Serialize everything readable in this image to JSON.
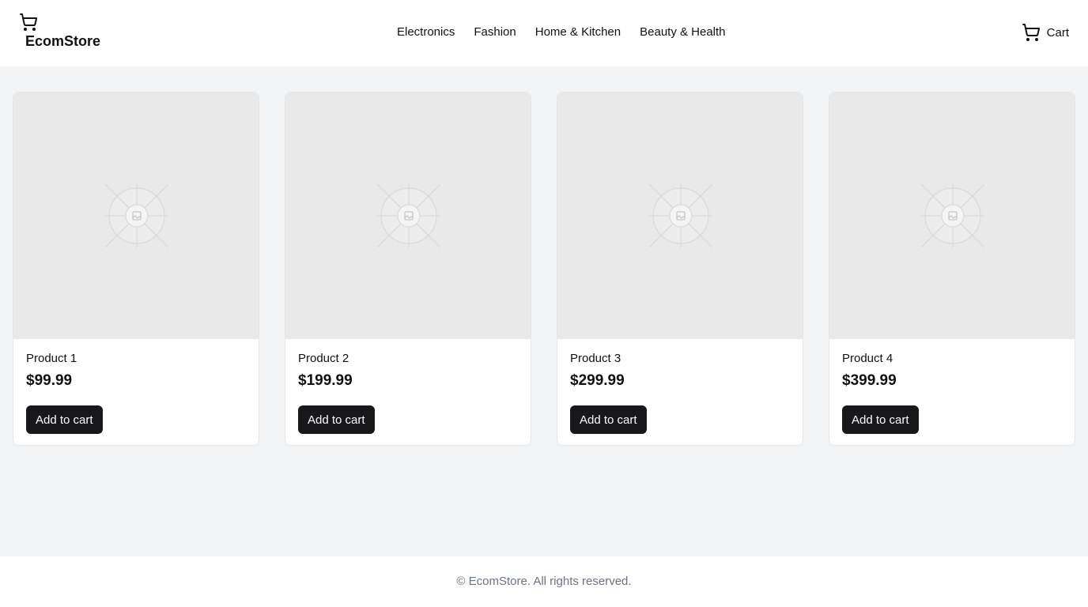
{
  "header": {
    "brand_icon": "shopping-cart-icon",
    "brand_name": "EcomStore",
    "nav": [
      {
        "label": "Electronics"
      },
      {
        "label": "Fashion"
      },
      {
        "label": "Home & Kitchen"
      },
      {
        "label": "Beauty & Health"
      }
    ],
    "cart_icon": "shopping-cart-icon",
    "cart_label": "Cart"
  },
  "products": [
    {
      "name": "Product 1",
      "price": "$99.99",
      "button_label": "Add to cart",
      "image_icon": "image-placeholder-icon"
    },
    {
      "name": "Product 2",
      "price": "$199.99",
      "button_label": "Add to cart",
      "image_icon": "image-placeholder-icon"
    },
    {
      "name": "Product 3",
      "price": "$299.99",
      "button_label": "Add to cart",
      "image_icon": "image-placeholder-icon"
    },
    {
      "name": "Product 4",
      "price": "$399.99",
      "button_label": "Add to cart",
      "image_icon": "image-placeholder-icon"
    }
  ],
  "footer": {
    "copyright": "© EcomStore. All rights reserved."
  },
  "colors": {
    "page_background": "#f2f3f5",
    "card_background": "#ffffff",
    "image_placeholder": "#e9e9ea",
    "button_background": "#18181b",
    "button_text": "#ffffff",
    "footer_text": "#6b7280"
  }
}
